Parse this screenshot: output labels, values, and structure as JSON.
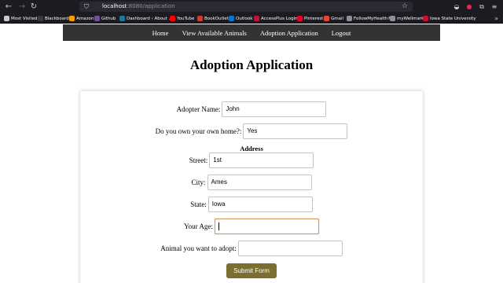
{
  "browser": {
    "url_host": "localhost",
    "url_rest": ":8080/application",
    "bookmarks": [
      {
        "label": "Most Visited",
        "icon": "gear-icon",
        "color": "#c9c9cf"
      },
      {
        "label": "Blackboard",
        "icon": "blackboard-icon",
        "color": "#3a3a3a"
      },
      {
        "label": "Amazon",
        "icon": "amazon-icon",
        "color": "#ff9900"
      },
      {
        "label": "Github",
        "icon": "github-icon",
        "color": "#6e5494"
      },
      {
        "label": "Dashboard ‹ About ...",
        "icon": "wordpress-icon",
        "color": "#21759b"
      },
      {
        "label": "YouTube",
        "icon": "youtube-icon",
        "color": "#ff0000"
      },
      {
        "label": "BookOutlet",
        "icon": "bookoutlet-icon",
        "color": "#e0342b"
      },
      {
        "label": "Outlook",
        "icon": "outlook-icon",
        "color": "#0078d4"
      },
      {
        "label": "AccessPlus Login",
        "icon": "accessplus-icon",
        "color": "#c8102e"
      },
      {
        "label": "Pinterest",
        "icon": "pinterest-icon",
        "color": "#e60023"
      },
      {
        "label": "Gmail",
        "icon": "gmail-icon",
        "color": "#ea4335"
      },
      {
        "label": "FollowMyHealth®",
        "icon": "globe-icon",
        "color": "#8f8f9d"
      },
      {
        "label": "myWellmark",
        "icon": "globe-icon",
        "color": "#8f8f9d"
      },
      {
        "label": "Iowa State University",
        "icon": "isu-icon",
        "color": "#c8102e"
      }
    ]
  },
  "nav": {
    "home": "Home",
    "animals": "View Available Animals",
    "application": "Adoption Application",
    "logout": "Logout"
  },
  "page": {
    "title": "Adoption Application"
  },
  "form": {
    "adopter_name_label": "Adopter Name:",
    "adopter_name_value": "John",
    "own_home_label": "Do you own your own home?:",
    "own_home_value": "Yes",
    "address_heading": "Address",
    "street_label": "Street:",
    "street_value": "1st",
    "city_label": "City:",
    "city_value": "Ames",
    "state_label": "State:",
    "state_value": "Iowa",
    "age_label": "Your Age:",
    "age_value": "",
    "animal_label": "Animal you want to adopt:",
    "animal_value": "",
    "submit_label": "Submit Form"
  },
  "colors": {
    "nav_bg": "#333333",
    "submit_bg": "#7a6f31",
    "focus_border": "#d29a5e",
    "chrome_bg": "#1c1b22"
  }
}
